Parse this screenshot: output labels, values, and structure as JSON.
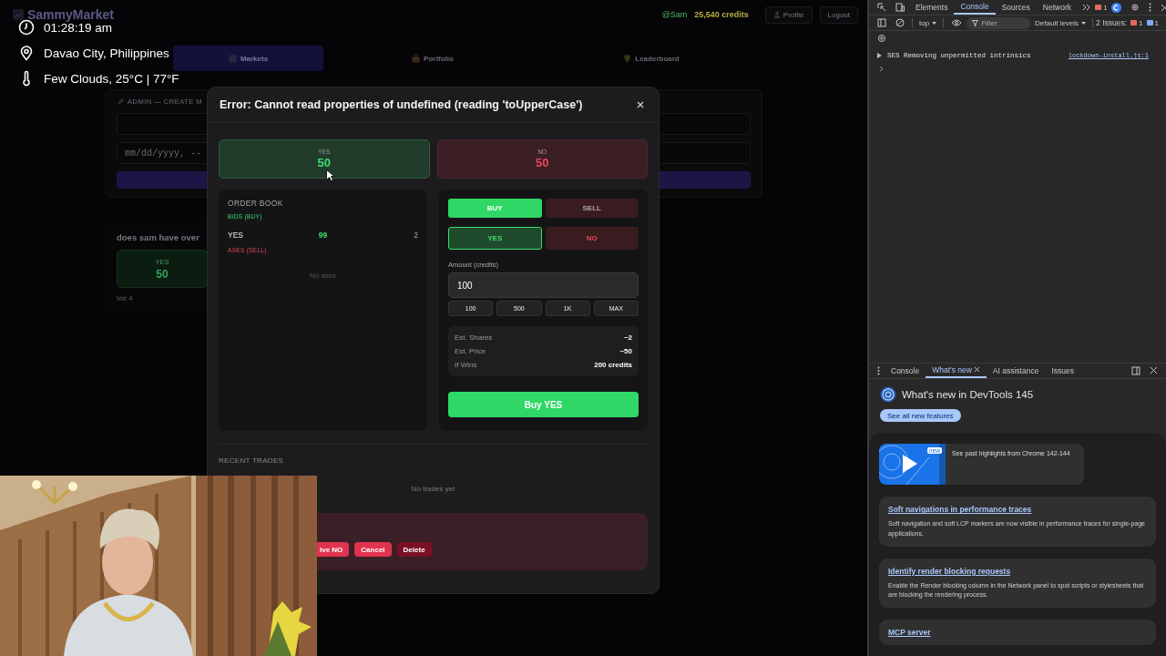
{
  "stream_overlay": {
    "time": "01:28:19 am",
    "location": "Davao City, Philippines",
    "weather": "Few Clouds, 25°C | 77°F"
  },
  "app": {
    "brand": "SammyMarket",
    "user": "@Sam",
    "credits": "25,540 credits",
    "header_buttons": [
      {
        "label": "Profile",
        "kind": "profile"
      },
      {
        "label": "Logout",
        "kind": "logout"
      }
    ],
    "nav_tabs": [
      {
        "label": "Markets",
        "selected": true,
        "kind": "markets"
      },
      {
        "label": "Portfolio",
        "selected": false,
        "kind": "portfolio"
      },
      {
        "label": "Leaderboard",
        "selected": false,
        "kind": "leaderboard"
      }
    ],
    "admin_panel": {
      "title": "ADMIN — CREATE M",
      "date_placeholder": "mm/dd/yyyy, --"
    },
    "market_card": {
      "question": "does sam have over",
      "yes_label": "YES",
      "yes_price": "50",
      "volume": "Vol: 4"
    }
  },
  "modal": {
    "title": "Error: Cannot read properties of undefined (reading 'toUpperCase')",
    "outcomes": [
      {
        "label": "YES",
        "price": "50",
        "kind": "yes"
      },
      {
        "label": "NO",
        "price": "50",
        "kind": "no"
      }
    ],
    "order_book": {
      "title": "ORDER BOOK",
      "bids_label": "BIDS (BUY)",
      "bids": [
        {
          "outcome": "YES",
          "price": "99",
          "quantity": "2"
        }
      ],
      "asks_label": "ASKS (SELL)",
      "asks_empty": "No asks"
    },
    "trade": {
      "sides": [
        {
          "label": "BUY",
          "selected": true
        },
        {
          "label": "SELL",
          "selected": false
        }
      ],
      "outcomes": [
        {
          "label": "YES",
          "selected": true,
          "kind": "yes"
        },
        {
          "label": "NO",
          "selected": false,
          "kind": "no"
        }
      ],
      "amount_label": "Amount (credits)",
      "amount_value": "100",
      "quick_amounts": [
        "100",
        "500",
        "1K",
        "MAX"
      ],
      "estimates": [
        {
          "label": "Est. Shares",
          "value": "~2"
        },
        {
          "label": "Est. Price",
          "value": "~50"
        },
        {
          "label": "If Wins",
          "value": "200 credits"
        }
      ],
      "submit": "Buy YES"
    },
    "recent_trades": {
      "title": "RECENT TRADES",
      "empty": "No trades yet"
    },
    "admin_actions": [
      {
        "label": "lve NO",
        "kind": "resolve"
      },
      {
        "label": "Cancel",
        "kind": "cancel"
      },
      {
        "label": "Delete",
        "kind": "delete"
      }
    ]
  },
  "devtools": {
    "tabs": [
      {
        "label": "Elements",
        "selected": false
      },
      {
        "label": "Console",
        "selected": true
      },
      {
        "label": "Sources",
        "selected": false
      },
      {
        "label": "Network",
        "selected": false
      }
    ],
    "error_count": "1",
    "context": "top",
    "filter_placeholder": "Filter",
    "levels": "Default levels",
    "issues_label": "2 Issues:",
    "issue_errors": "1",
    "issue_info": "1",
    "messages": [
      {
        "text": "SES Removing unpermitted intrinsics",
        "source": "lockdown-install.js:1"
      }
    ],
    "drawer": {
      "tabs": [
        {
          "label": "Console",
          "selected": false,
          "closable": false
        },
        {
          "label": "What's new",
          "selected": true,
          "closable": true
        },
        {
          "label": "AI assistance",
          "selected": false,
          "closable": false
        },
        {
          "label": "Issues",
          "selected": false,
          "closable": false
        }
      ],
      "heading": "What's new in DevTools 145",
      "button": "See all new features",
      "video": {
        "badge": "new",
        "caption": "See past highlights from Chrome 142-144"
      },
      "features": [
        {
          "title": "Soft navigations in performance traces",
          "description": "Soft navigation and soft LCP markers are now visible in performance traces for single-page applications."
        },
        {
          "title": "Identify render blocking requests",
          "description": "Enable the Render blocking column in the Network panel to spot scripts or stylesheets that are blocking the rendering process."
        },
        {
          "title": "MCP server"
        }
      ]
    }
  }
}
